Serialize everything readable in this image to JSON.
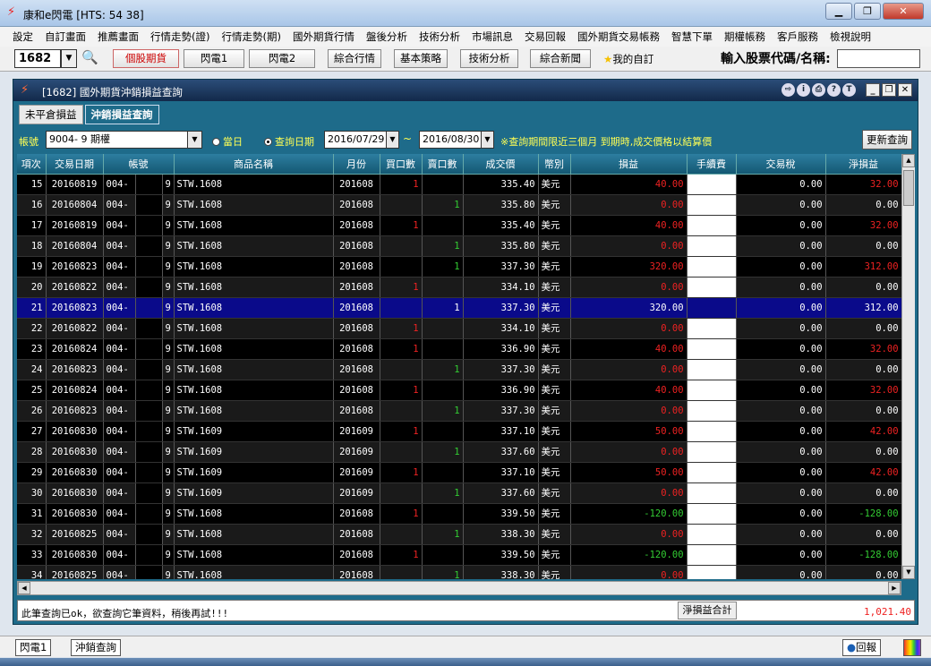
{
  "window": {
    "title": "康和e閃電 [HTS: 54 38]"
  },
  "menu": [
    "設定",
    "自訂畫面",
    "推薦畫面",
    "行情走勢(證)",
    "行情走勢(期)",
    "國外期貨行情",
    "盤後分析",
    "技術分析",
    "市場訊息",
    "交易回報",
    "國外期貨交易帳務",
    "智慧下單",
    "期權帳務",
    "客戶服務",
    "檢視說明"
  ],
  "toolbar": {
    "code": "1682",
    "buttons": [
      "個股期貨",
      "閃電1",
      "閃電2",
      "綜合行情",
      "基本策略",
      "技術分析",
      "綜合新聞"
    ],
    "favorite": "我的自訂",
    "stock_label": "輸入股票代碼/名稱:"
  },
  "inner": {
    "title": "[1682] 國外期貨沖銷損益查詢",
    "tabs": [
      "未平倉損益",
      "沖銷損益查詢"
    ]
  },
  "filter": {
    "account_label": "帳號",
    "account_value": "9004-         9 期權",
    "radio_today": "當日",
    "radio_query_date": "查詢日期",
    "start_date": "2016/07/29",
    "end_date": "2016/08/30",
    "tilde": "~",
    "note": "※查詢期間限近三個月 到期時,成交價格以結算價",
    "refresh": "更新查詢"
  },
  "table": {
    "columns": [
      "項次",
      "交易日期",
      "帳號",
      "商品名稱",
      "月份",
      "買口數",
      "賣口數",
      "成交價",
      "幣別",
      "損益",
      "手續費",
      "交易稅",
      "淨損益"
    ],
    "selected_index": 6,
    "rows": [
      [
        "15",
        "20160819",
        "004-",
        "9",
        "STW.1608",
        "201608",
        "1",
        "",
        "335.40",
        "美元",
        "40.00",
        "",
        "0.00",
        "32.00"
      ],
      [
        "16",
        "20160804",
        "004-",
        "9",
        "STW.1608",
        "201608",
        "",
        "1",
        "335.80",
        "美元",
        "0.00",
        "",
        "0.00",
        "0.00"
      ],
      [
        "17",
        "20160819",
        "004-",
        "9",
        "STW.1608",
        "201608",
        "1",
        "",
        "335.40",
        "美元",
        "40.00",
        "",
        "0.00",
        "32.00"
      ],
      [
        "18",
        "20160804",
        "004-",
        "9",
        "STW.1608",
        "201608",
        "",
        "1",
        "335.80",
        "美元",
        "0.00",
        "",
        "0.00",
        "0.00"
      ],
      [
        "19",
        "20160823",
        "004-",
        "9",
        "STW.1608",
        "201608",
        "",
        "1",
        "337.30",
        "美元",
        "320.00",
        "",
        "0.00",
        "312.00"
      ],
      [
        "20",
        "20160822",
        "004-",
        "9",
        "STW.1608",
        "201608",
        "1",
        "",
        "334.10",
        "美元",
        "0.00",
        "",
        "0.00",
        "0.00"
      ],
      [
        "21",
        "20160823",
        "004-",
        "9",
        "STW.1608",
        "201608",
        "",
        "1",
        "337.30",
        "美元",
        "320.00",
        "",
        "0.00",
        "312.00"
      ],
      [
        "22",
        "20160822",
        "004-",
        "9",
        "STW.1608",
        "201608",
        "1",
        "",
        "334.10",
        "美元",
        "0.00",
        "",
        "0.00",
        "0.00"
      ],
      [
        "23",
        "20160824",
        "004-",
        "9",
        "STW.1608",
        "201608",
        "1",
        "",
        "336.90",
        "美元",
        "40.00",
        "",
        "0.00",
        "32.00"
      ],
      [
        "24",
        "20160823",
        "004-",
        "9",
        "STW.1608",
        "201608",
        "",
        "1",
        "337.30",
        "美元",
        "0.00",
        "",
        "0.00",
        "0.00"
      ],
      [
        "25",
        "20160824",
        "004-",
        "9",
        "STW.1608",
        "201608",
        "1",
        "",
        "336.90",
        "美元",
        "40.00",
        "",
        "0.00",
        "32.00"
      ],
      [
        "26",
        "20160823",
        "004-",
        "9",
        "STW.1608",
        "201608",
        "",
        "1",
        "337.30",
        "美元",
        "0.00",
        "",
        "0.00",
        "0.00"
      ],
      [
        "27",
        "20160830",
        "004-",
        "9",
        "STW.1609",
        "201609",
        "1",
        "",
        "337.10",
        "美元",
        "50.00",
        "",
        "0.00",
        "42.00"
      ],
      [
        "28",
        "20160830",
        "004-",
        "9",
        "STW.1609",
        "201609",
        "",
        "1",
        "337.60",
        "美元",
        "0.00",
        "",
        "0.00",
        "0.00"
      ],
      [
        "29",
        "20160830",
        "004-",
        "9",
        "STW.1609",
        "201609",
        "1",
        "",
        "337.10",
        "美元",
        "50.00",
        "",
        "0.00",
        "42.00"
      ],
      [
        "30",
        "20160830",
        "004-",
        "9",
        "STW.1609",
        "201609",
        "",
        "1",
        "337.60",
        "美元",
        "0.00",
        "",
        "0.00",
        "0.00"
      ],
      [
        "31",
        "20160830",
        "004-",
        "9",
        "STW.1608",
        "201608",
        "1",
        "",
        "339.50",
        "美元",
        "-120.00",
        "",
        "0.00",
        "-128.00"
      ],
      [
        "32",
        "20160825",
        "004-",
        "9",
        "STW.1608",
        "201608",
        "",
        "1",
        "338.30",
        "美元",
        "0.00",
        "",
        "0.00",
        "0.00"
      ],
      [
        "33",
        "20160830",
        "004-",
        "9",
        "STW.1608",
        "201608",
        "1",
        "",
        "339.50",
        "美元",
        "-120.00",
        "",
        "0.00",
        "-128.00"
      ],
      [
        "34",
        "20160825",
        "004-",
        "9",
        "STW.1608",
        "201608",
        "",
        "1",
        "338.30",
        "美元",
        "0.00",
        "",
        "0.00",
        "0.00"
      ]
    ]
  },
  "status": {
    "message": "此筆查詢已ok，欲查詢它筆資料，稍後再試!!!",
    "total_label": "淨損益合計",
    "total_value": "1,021.40"
  },
  "bottom": {
    "tabs": [
      "閃電1",
      "沖銷查詢"
    ],
    "report": "回報"
  },
  "colors": {
    "profit": "#e22",
    "loss": "#3c3",
    "selected_row": "#0a0a8a"
  }
}
